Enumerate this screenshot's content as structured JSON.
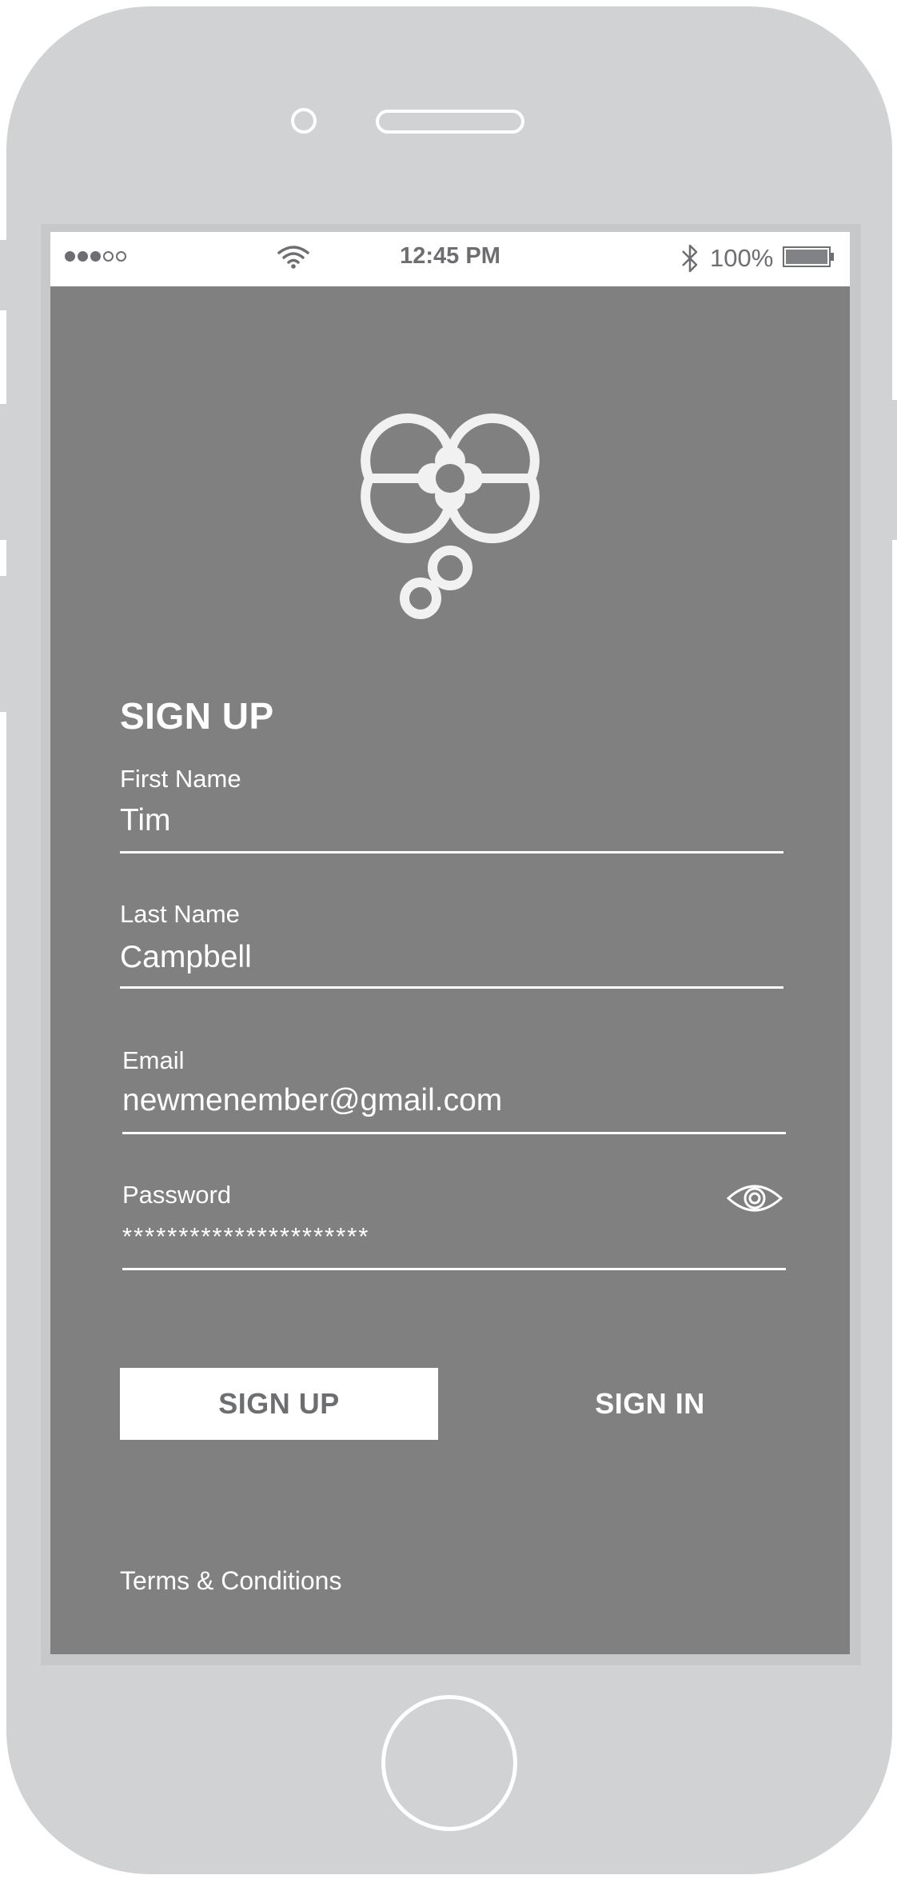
{
  "status_bar": {
    "signal_icon": "signal-dots-icon",
    "wifi_icon": "wifi-icon",
    "time": "12:45 PM",
    "bluetooth_icon": "bluetooth-icon",
    "battery_percent": "100%",
    "battery_icon": "battery-icon"
  },
  "logo_icon": "flower-logo-icon",
  "form": {
    "heading": "SIGN UP",
    "first_name": {
      "label": "First Name",
      "value": "Tim"
    },
    "last_name": {
      "label": "Last Name",
      "value": "Campbell"
    },
    "email": {
      "label": "Email",
      "value": "newmenember@gmail.com"
    },
    "password": {
      "label": "Password",
      "value": "**********************",
      "toggle_icon": "eye-icon"
    }
  },
  "actions": {
    "sign_up_label": "SIGN UP",
    "sign_in_label": "SIGN IN"
  },
  "footer": {
    "terms_label": "Terms & Conditions"
  },
  "colors": {
    "screen_background": "#808080",
    "device_frame": "#d1d2d4",
    "foreground": "#ffffff"
  }
}
